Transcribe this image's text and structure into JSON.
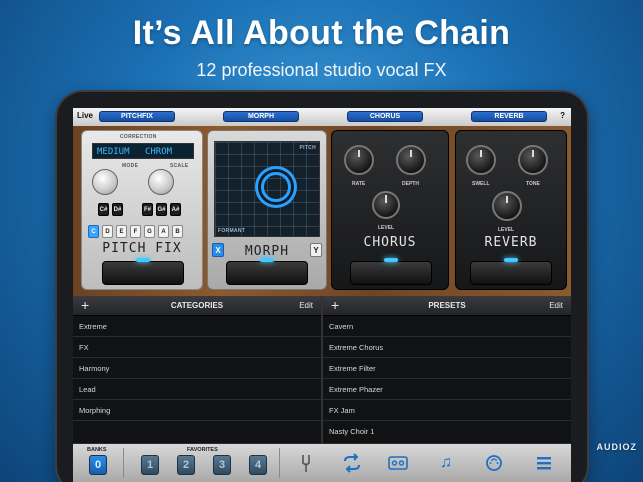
{
  "promo": {
    "headline": "It’s All About the Chain",
    "subheadline": "12 professional studio vocal FX"
  },
  "topbar": {
    "live_label": "Live",
    "help_label": "?",
    "slots": [
      "PITCHFIX",
      "MORPH",
      "CHORUS",
      "REVERB"
    ]
  },
  "pitchfix": {
    "correction_label": "CORRECTION",
    "lcd_left": "MEDIUM",
    "lcd_right": "CHROM",
    "mode_label": "MODE",
    "scale_label": "SCALE",
    "keys": [
      "C#",
      "D#",
      "F#",
      "G#",
      "A#",
      "C",
      "D",
      "E",
      "F",
      "G",
      "A",
      "B"
    ],
    "name": "PITCH FIX"
  },
  "morph": {
    "pitch_label": "PITCH",
    "formant_label": "FORMANT",
    "x_label": "X",
    "y_label": "Y",
    "name": "MORPH"
  },
  "chorus": {
    "rate_label": "RATE",
    "depth_label": "DEPTH",
    "level_label": "LEVEL",
    "name": "CHORUS"
  },
  "reverb": {
    "swell_label": "SWELL",
    "tone_label": "TONE",
    "level_label": "LEVEL",
    "name": "REVERB"
  },
  "categories": {
    "plus": "+",
    "title": "CATEGORIES",
    "edit": "Edit",
    "items": [
      "Extreme",
      "FX",
      "Harmony",
      "Lead",
      "Morphing"
    ]
  },
  "presets": {
    "plus": "+",
    "title": "PRESETS",
    "edit": "Edit",
    "items": [
      "Cavern",
      "Extreme Chorus",
      "Extreme Filter",
      "Extreme Phazer",
      "FX Jam",
      "Nasty Choir 1"
    ]
  },
  "bottombar": {
    "banks_label": "BANKS",
    "bank_value": "0",
    "favorites_label": "FAVORITES",
    "favorites": [
      "1",
      "2",
      "3",
      "4"
    ],
    "icons": [
      "tuning-fork-icon",
      "loop-icon",
      "tape-icon",
      "music-note-icon",
      "midi-icon",
      "menu-icon"
    ]
  },
  "watermark": "AUDIOZ",
  "colors": {
    "accent": "#2aa0ff",
    "background_blue": "#1b6fb3"
  }
}
